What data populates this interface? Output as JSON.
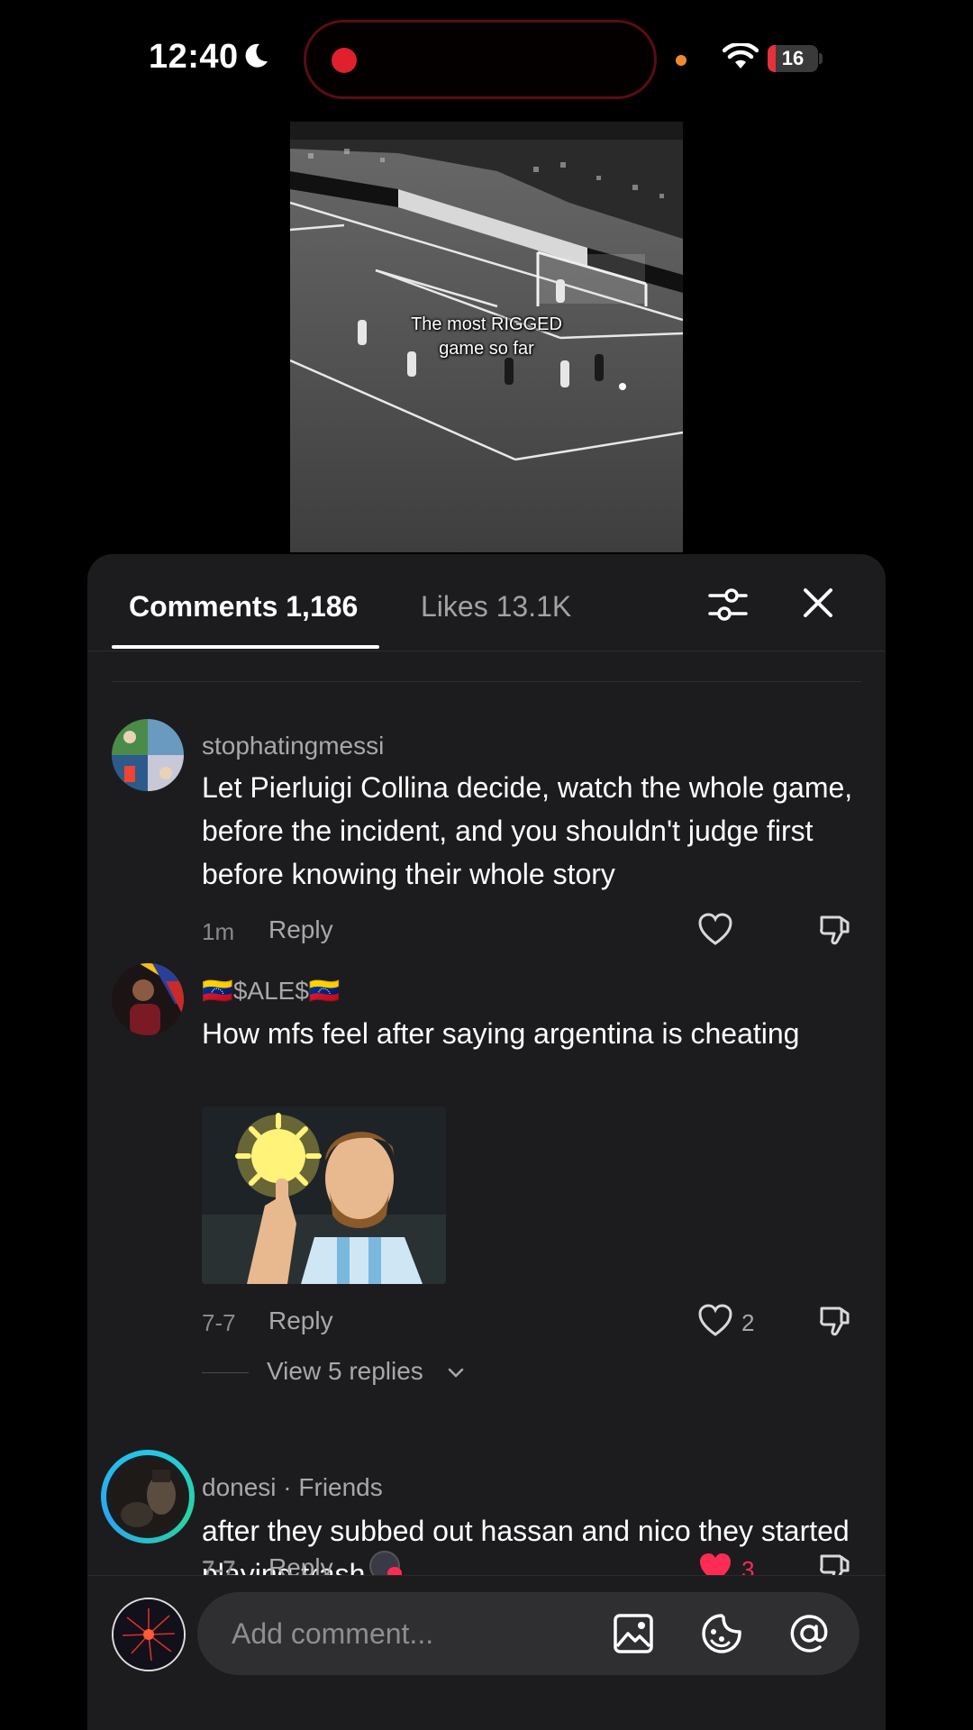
{
  "status_bar": {
    "time": "12:40",
    "battery_level": "16",
    "battery_fraction": 0.16,
    "icons": [
      "moon-icon",
      "record-indicator",
      "wifi-icon",
      "battery-icon"
    ]
  },
  "video": {
    "caption_line1": "The most RIGGED",
    "caption_line2": "game so far"
  },
  "tabs": {
    "comments_label": "Comments 1,186",
    "likes_label": "Likes 13.1K",
    "active": "comments"
  },
  "comments": [
    {
      "username": "stophatingmessi",
      "text": "Let Pierluigi Collina decide, watch the whole game, before the incident, and you shouldn't judge first before knowing their whole story",
      "time": "1m",
      "reply_label": "Reply",
      "likes": ""
    },
    {
      "username": "🇻🇪$ALE$🇻🇪",
      "text": "How mfs feel after saying argentina is cheating",
      "time": "7-7",
      "reply_label": "Reply",
      "likes": "2",
      "view_replies": "View 5 replies"
    },
    {
      "username": "donesi · Friends",
      "text": "after they subbed out hassan and nico they started playing trash",
      "time": "7-7",
      "reply_label": "Reply",
      "likes": "3",
      "liked": true
    }
  ],
  "input": {
    "placeholder": "Add comment..."
  },
  "colors": {
    "sheet_bg": "#1c1c1e",
    "accent_red": "#fe2c55",
    "friend_ring": "#23c8e8"
  }
}
